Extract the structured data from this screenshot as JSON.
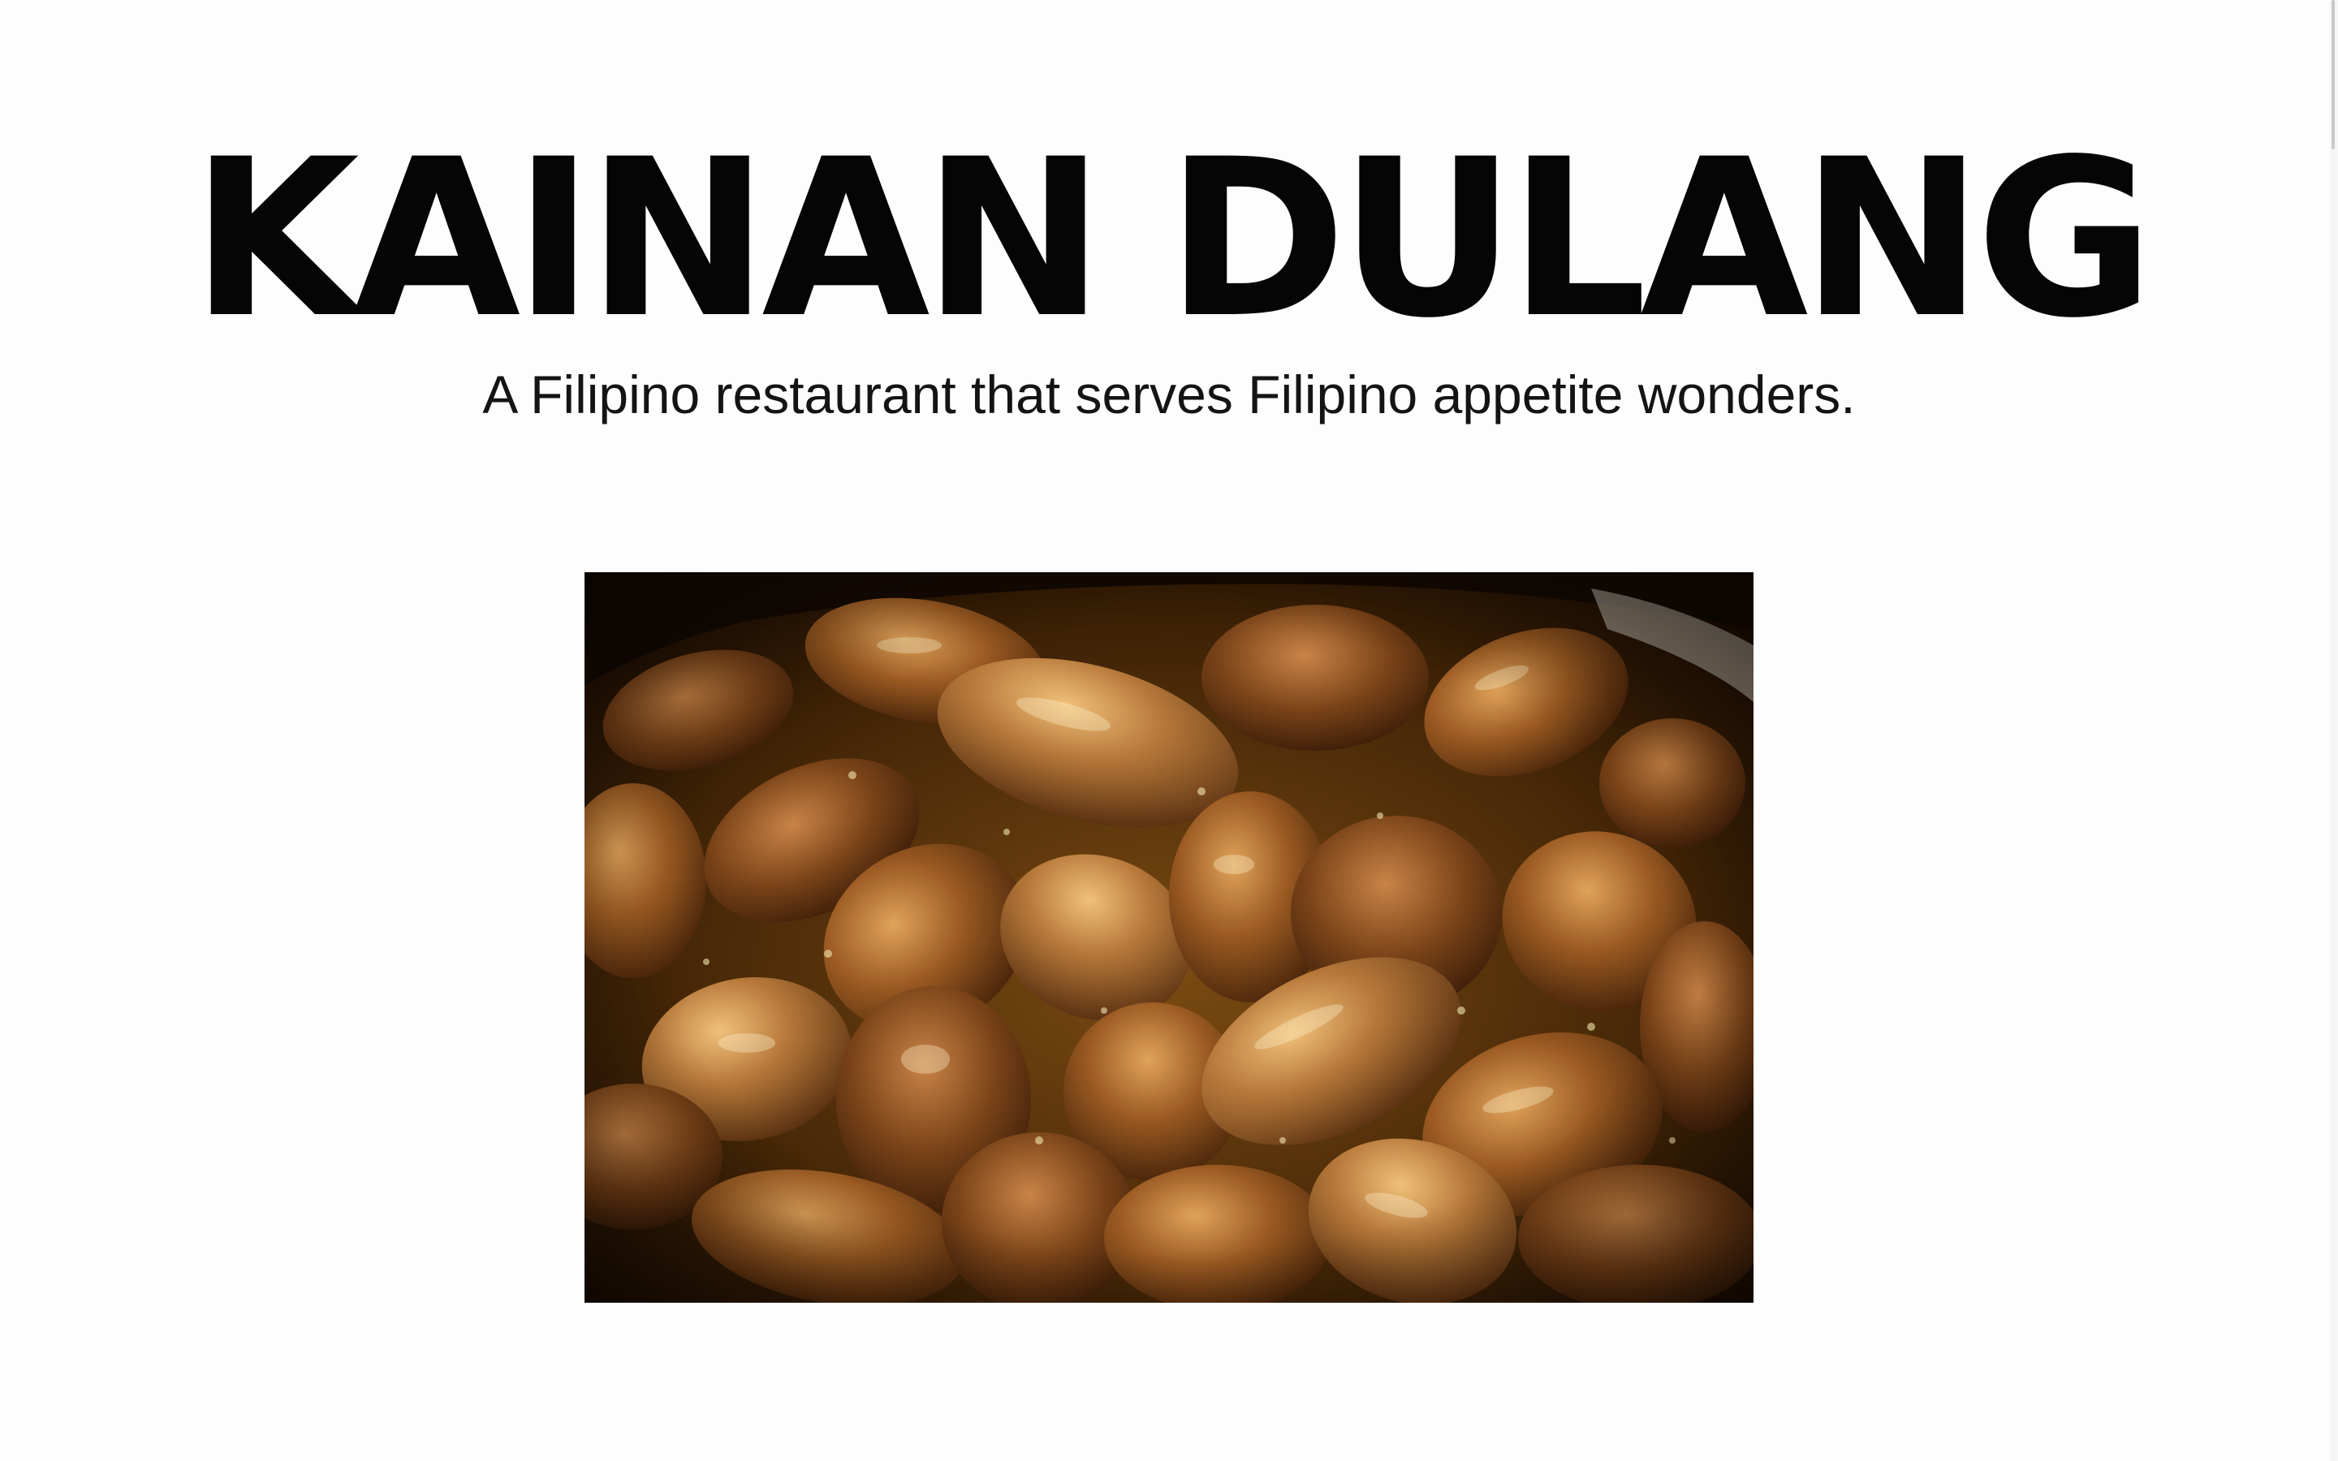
{
  "hero": {
    "title": "KAINAN DULANG",
    "tagline": "A Filipino restaurant that serves Filipino appetite wonders."
  },
  "colors": {
    "background": "#fdfdfd",
    "title": "#050505",
    "tagline": "#141414"
  }
}
